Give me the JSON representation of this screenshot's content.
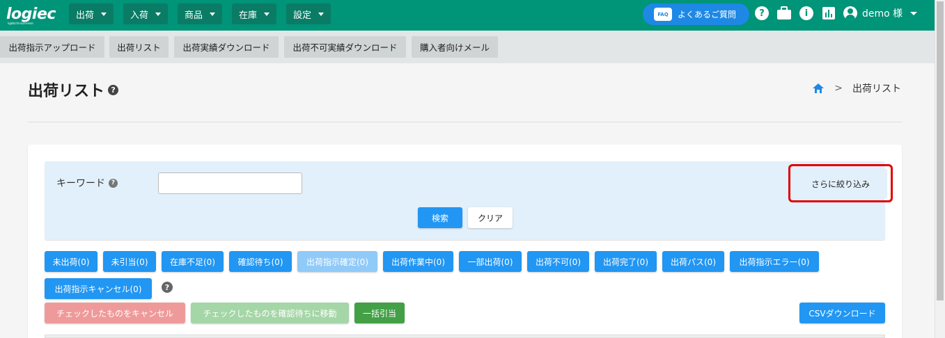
{
  "header": {
    "logo_text": "logiec",
    "logo_tagline": "logistics for ecommerce",
    "menus": [
      {
        "label": "出荷"
      },
      {
        "label": "入荷"
      },
      {
        "label": "商品"
      },
      {
        "label": "在庫"
      },
      {
        "label": "設定"
      }
    ],
    "faq": {
      "icon_text": "FAQ",
      "label": "よくあるご質問"
    },
    "icons": [
      "help-icon",
      "briefcase-icon",
      "info-icon",
      "chart-icon"
    ],
    "user": "demo 様"
  },
  "subnav": {
    "items": [
      {
        "label": "出荷指示アップロード"
      },
      {
        "label": "出荷リスト"
      },
      {
        "label": "出荷実績ダウンロード"
      },
      {
        "label": "出荷不可実績ダウンロード"
      },
      {
        "label": "購入者向けメール"
      }
    ]
  },
  "page": {
    "title": "出荷リスト",
    "help_glyph": "?",
    "breadcrumb": {
      "separator": ">",
      "current": "出荷リスト"
    }
  },
  "search": {
    "keyword_label": "キーワード",
    "keyword_value": "",
    "more_filter": "さらに絞り込み",
    "search_button": "検索",
    "clear_button": "クリア"
  },
  "status_filters": [
    {
      "label": "未出荷(0)"
    },
    {
      "label": "未引当(0)"
    },
    {
      "label": "在庫不足(0)"
    },
    {
      "label": "確認待ち(0)"
    },
    {
      "label": "出荷指示確定(0)"
    },
    {
      "label": "出荷作業中(0)"
    },
    {
      "label": "一部出荷(0)"
    },
    {
      "label": "出荷不可(0)"
    },
    {
      "label": "出荷完了(0)"
    },
    {
      "label": "出荷パス(0)"
    },
    {
      "label": "出荷指示エラー(0)"
    },
    {
      "label": "出荷指示キャンセル(0)"
    }
  ],
  "actions": {
    "cancel_checked": "チェックしたものをキャンセル",
    "move_to_pending": "チェックしたものを確認待ちに移動",
    "bulk_allocate": "一括引当",
    "csv_download": "CSVダウンロード"
  },
  "colors": {
    "primary": "#009479",
    "accent_blue": "#2196f3",
    "highlight_red": "#e00000"
  }
}
